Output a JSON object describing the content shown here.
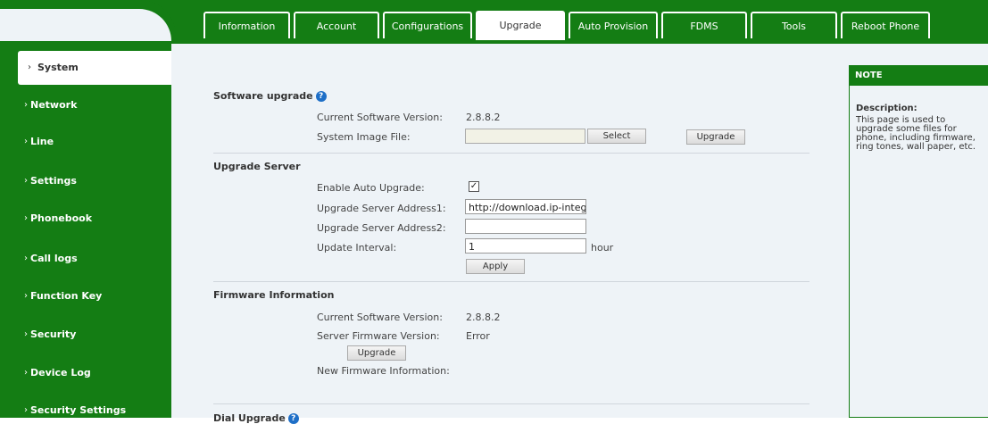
{
  "tabs": [
    {
      "label": "Information"
    },
    {
      "label": "Account"
    },
    {
      "label": "Configurations"
    },
    {
      "label": "Upgrade"
    },
    {
      "label": "Auto Provision"
    },
    {
      "label": "FDMS"
    },
    {
      "label": "Tools"
    },
    {
      "label": "Reboot Phone"
    }
  ],
  "sidebar": {
    "items": [
      {
        "label": "System"
      },
      {
        "label": "Network"
      },
      {
        "label": "Line"
      },
      {
        "label": "Settings"
      },
      {
        "label": "Phonebook"
      },
      {
        "label": "Call logs"
      },
      {
        "label": "Function Key"
      },
      {
        "label": "Security"
      },
      {
        "label": "Device Log"
      },
      {
        "label": "Security Settings"
      }
    ]
  },
  "software_upgrade": {
    "title": "Software upgrade",
    "current_version_label": "Current Software Version:",
    "current_version_value": "2.8.8.2",
    "image_file_label": "System Image File:",
    "image_file_value": "",
    "select_label": "Select",
    "upgrade_label": "Upgrade"
  },
  "upgrade_server": {
    "title": "Upgrade Server",
    "enable_label": "Enable Auto Upgrade:",
    "enable_checked": true,
    "address1_label": "Upgrade Server Address1:",
    "address1_value": "http://download.ip-integr",
    "address2_label": "Upgrade Server Address2:",
    "address2_value": "",
    "interval_label": "Update Interval:",
    "interval_value": "1",
    "interval_unit": "hour",
    "apply_label": "Apply"
  },
  "firmware_info": {
    "title": "Firmware Information",
    "current_version_label": "Current Software Version:",
    "current_version_value": "2.8.8.2",
    "server_version_label": "Server Firmware Version:",
    "server_version_value": "Error",
    "upgrade_label": "Upgrade",
    "new_info_label": "New Firmware Information:"
  },
  "next_section": {
    "title_partial": "Dial Upgrade"
  },
  "note": {
    "header": "NOTE",
    "title": "Description:",
    "text": "This page is used to upgrade some files for phone, including firmware, ring tones, wall paper, etc."
  },
  "colors": {
    "brand_green": "#147d14",
    "content_bg": "#eef3f7",
    "help_blue": "#1e6fc7"
  }
}
